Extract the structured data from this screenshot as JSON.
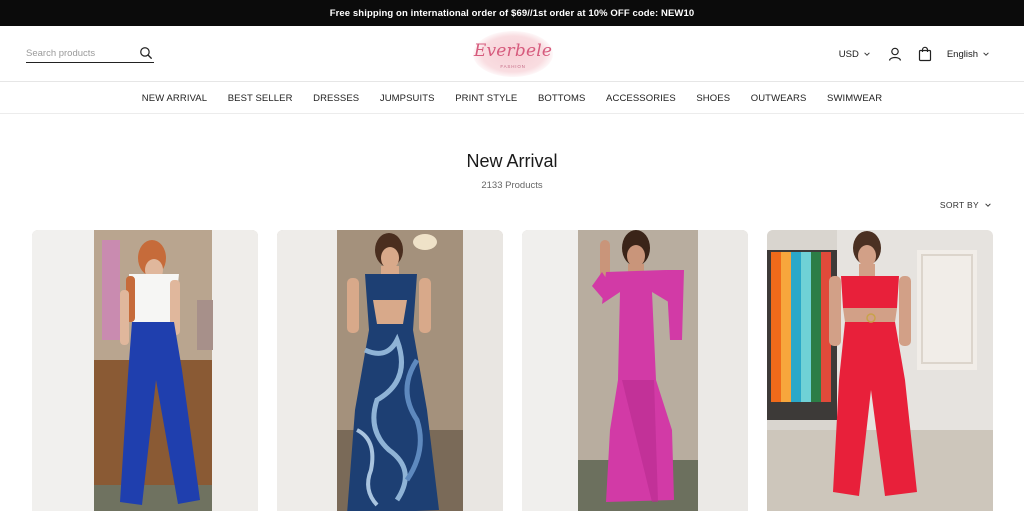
{
  "announcement": "Free shipping on international order of $69//1st order at 10% OFF code: NEW10",
  "header": {
    "search_placeholder": "Search products",
    "logo_text": "Everbele",
    "logo_sub": "FASHION",
    "currency": "USD",
    "language": "English"
  },
  "nav": {
    "items": [
      "NEW ARRIVAL",
      "BEST SELLER",
      "DRESSES",
      "JUMPSUITS",
      "PRINT STYLE",
      "BOTTOMS",
      "ACCESSORIES",
      "SHOES",
      "OUTWEARS",
      "SWIMWEAR"
    ]
  },
  "collection": {
    "title": "New Arrival",
    "count": "2133 Products",
    "sort_label": "SORT BY"
  },
  "products": [
    {
      "description": "white corset top with blue wide-leg pants",
      "accent": "#1f3fae",
      "top": "#f2f2f2"
    },
    {
      "description": "blue printed maxi dress with cutout",
      "accent": "#2a5f9e",
      "top": "#1d3f73"
    },
    {
      "description": "magenta puff-sleeve maxi dress",
      "accent": "#d23aa6",
      "top": "#d23aa6"
    },
    {
      "description": "red cutout wide-leg jumpsuit",
      "accent": "#e8203a",
      "top": "#e8203a"
    }
  ],
  "icons": {
    "search": "search-icon",
    "account": "user-icon",
    "cart": "bag-icon",
    "chevron": "chevron-down-icon"
  }
}
